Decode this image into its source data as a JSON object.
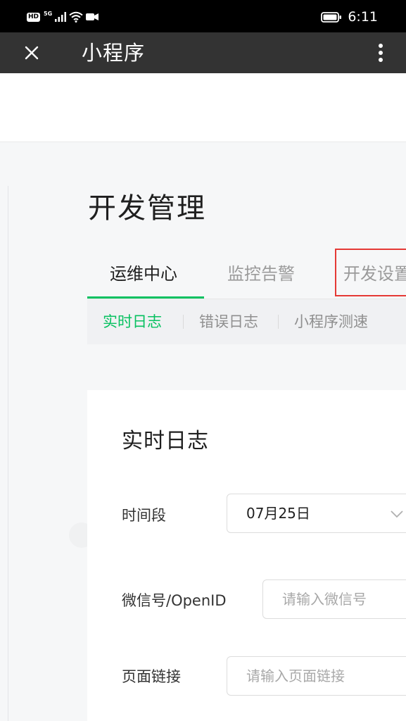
{
  "status_bar": {
    "hd": "HD",
    "network": "5G",
    "time": "6:11"
  },
  "title_bar": {
    "title": "小程序",
    "close_icon": "close-icon",
    "more_icon": "more-vertical-icon"
  },
  "page": {
    "title": "开发管理",
    "tabs": [
      {
        "label": "运维中心",
        "active": true
      },
      {
        "label": "监控告警",
        "active": false
      },
      {
        "label": "开发设置",
        "active": false
      }
    ],
    "subtabs": [
      {
        "label": "实时日志",
        "active": true
      },
      {
        "label": "错误日志",
        "active": false
      },
      {
        "label": "小程序测速",
        "active": false
      }
    ]
  },
  "card": {
    "title": "实时日志",
    "time_label": "时间段",
    "time_value": "07月25日",
    "openid_label": "微信号/OpenID",
    "openid_placeholder": "请输入微信号",
    "page_label": "页面链接",
    "page_placeholder": "请输入页面链接"
  },
  "colors": {
    "accent": "#07c160",
    "highlight": "#e53935",
    "title_bar": "#333333",
    "page_bg": "#f6f7f8"
  }
}
